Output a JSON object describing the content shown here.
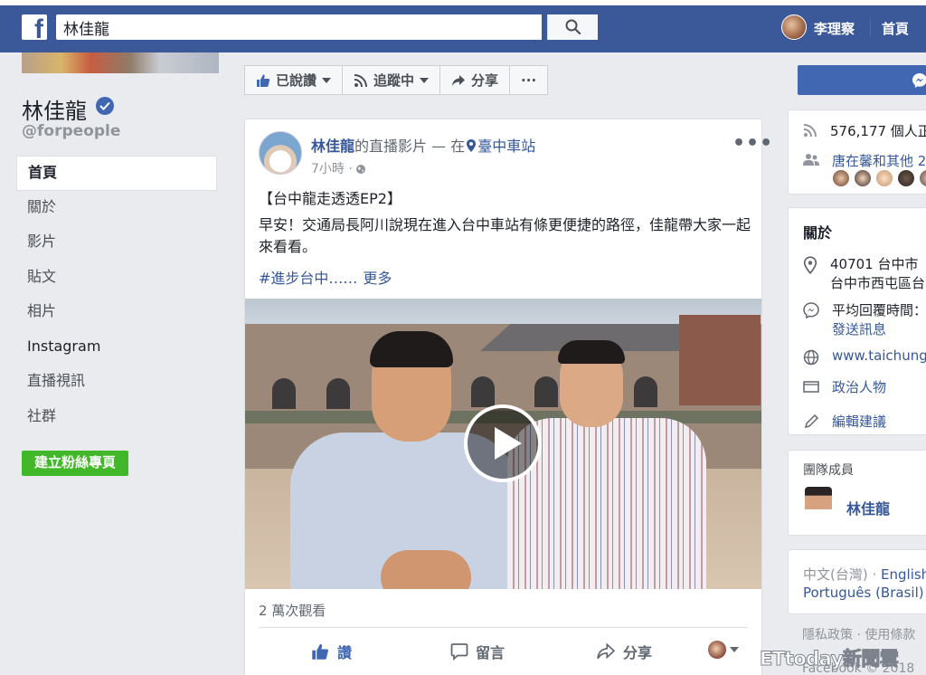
{
  "topbar": {
    "logo": "f",
    "search_value": "林佳龍",
    "user_name": "李理察",
    "home": "首頁"
  },
  "page": {
    "name": "林佳龍",
    "handle": "@forpeople",
    "nav": [
      "首頁",
      "關於",
      "影片",
      "貼文",
      "相片",
      "Instagram",
      "直播視訊",
      "社群"
    ],
    "create_button": "建立粉絲專頁"
  },
  "actions": {
    "liked": "已說讚",
    "following": "追蹤中",
    "share": "分享",
    "more": "···"
  },
  "post": {
    "author": "林佳龍",
    "header_mid": "的直播影片 — 在",
    "location": "臺中車站",
    "time": "7小時 ·",
    "title": "【台中龍走透透EP2】",
    "body": "早安！交通局長阿川說現在進入台中車站有條更便捷的路徑，佳龍帶大家一起來看看。",
    "tags": "#進步台中……",
    "more_link": "更多",
    "views": "2 萬次觀看",
    "like": "讚",
    "comment": "留言",
    "share": "分享"
  },
  "sidebar": {
    "followers": "576,177 個人正",
    "friends_like": "唐在馨和其他 2",
    "about_heading": "關於",
    "address_line1": "40701 台中市",
    "address_line2": "台中市西屯區台",
    "response_line1": "平均回覆時間：",
    "response_line2": "發送訊息",
    "website": "www.taichung.g",
    "category": "政治人物",
    "suggest_edit": "編輯建議",
    "team_heading": "團隊成員",
    "team_member": "林佳龍",
    "lang_primary": "中文(台灣) ·",
    "lang_english": "English",
    "lang_portuguese": "Português (Brasil)",
    "lang_sep": "·",
    "footer1": "隱私政策 · 使用條款",
    "footer2": "Facebook © 2018"
  },
  "watermark": "ETtoday新聞雲",
  "colors": {
    "facebook_blue": "#3b5998",
    "link_blue": "#365899",
    "create_green": "#42b72a",
    "page_bg": "#e9ebee"
  }
}
